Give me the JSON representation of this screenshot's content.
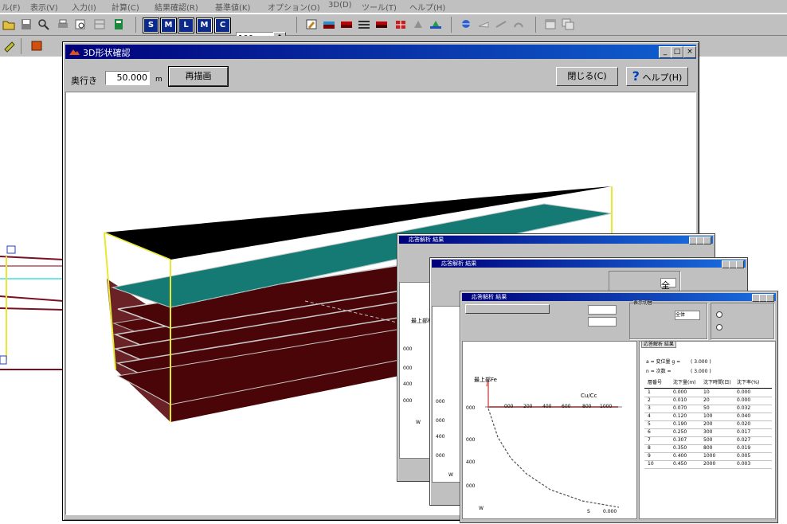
{
  "menubar": {
    "items": [
      "ル(F)",
      "表示(V)",
      "入力(I)",
      "計算(C)",
      "結果確認(R)",
      "基準値(K)",
      "オプション(O)",
      "3D(D)",
      "ツール(T)",
      "ヘルプ(H)"
    ]
  },
  "toolbar": {
    "size_buttons": [
      "S",
      "M",
      "L",
      "M",
      "C"
    ],
    "zoom_value": "100"
  },
  "win3d": {
    "title": "3D形状確認",
    "depth_label": "奥行き",
    "depth_value": "50.000",
    "depth_unit": "m",
    "redraw_label": "再描画",
    "close_label": "閉じる(C)",
    "help_label": "ヘルプ(H)"
  },
  "result_window": {
    "title": "応答解析 結果",
    "tab_label": "応答解析 結果",
    "group_label": "表示切替",
    "combo_value": "全体",
    "plot_label": "最上部Fe",
    "curve_label": "Cu/Cc",
    "x_ticks": [
      "000",
      "200",
      "400",
      "600",
      "800",
      "1000"
    ],
    "y_ticks": [
      "000",
      "000",
      "400",
      "000"
    ],
    "axis_w": "W",
    "axis_s": "S",
    "s_value": "0.000",
    "param_a": "a =  変位量 g =",
    "param_a_value": "( 3.000 )",
    "param_b": "n =  次数 =",
    "param_b_value": "( 3.000 )",
    "table_headers": [
      "層番号",
      "沈下量(m)",
      "沈下時間(日)",
      "沈下率(%)"
    ],
    "table_rows": [
      [
        "1",
        "0.000",
        "10",
        "0.000"
      ],
      [
        "2",
        "0.010",
        "20",
        "0.000"
      ],
      [
        "3",
        "0.070",
        "50",
        "0.032"
      ],
      [
        "4",
        "0.120",
        "100",
        "0.040"
      ],
      [
        "5",
        "0.190",
        "200",
        "0.020"
      ],
      [
        "6",
        "0.250",
        "300",
        "0.017"
      ],
      [
        "7",
        "0.307",
        "500",
        "0.027"
      ],
      [
        "8",
        "0.350",
        "800",
        "0.019"
      ],
      [
        "9",
        "0.400",
        "1000",
        "0.005"
      ],
      [
        "10",
        "0.450",
        "2000",
        "0.003"
      ]
    ]
  },
  "colors": {
    "title_bar_start": "#00007a",
    "title_bar_end": "#1060d0",
    "face": "#c0c0c0",
    "soil_layer": "#4a0508",
    "teal_layer": "#157a74",
    "top_layer": "#000000",
    "edge_yellow": "#e8e830"
  }
}
